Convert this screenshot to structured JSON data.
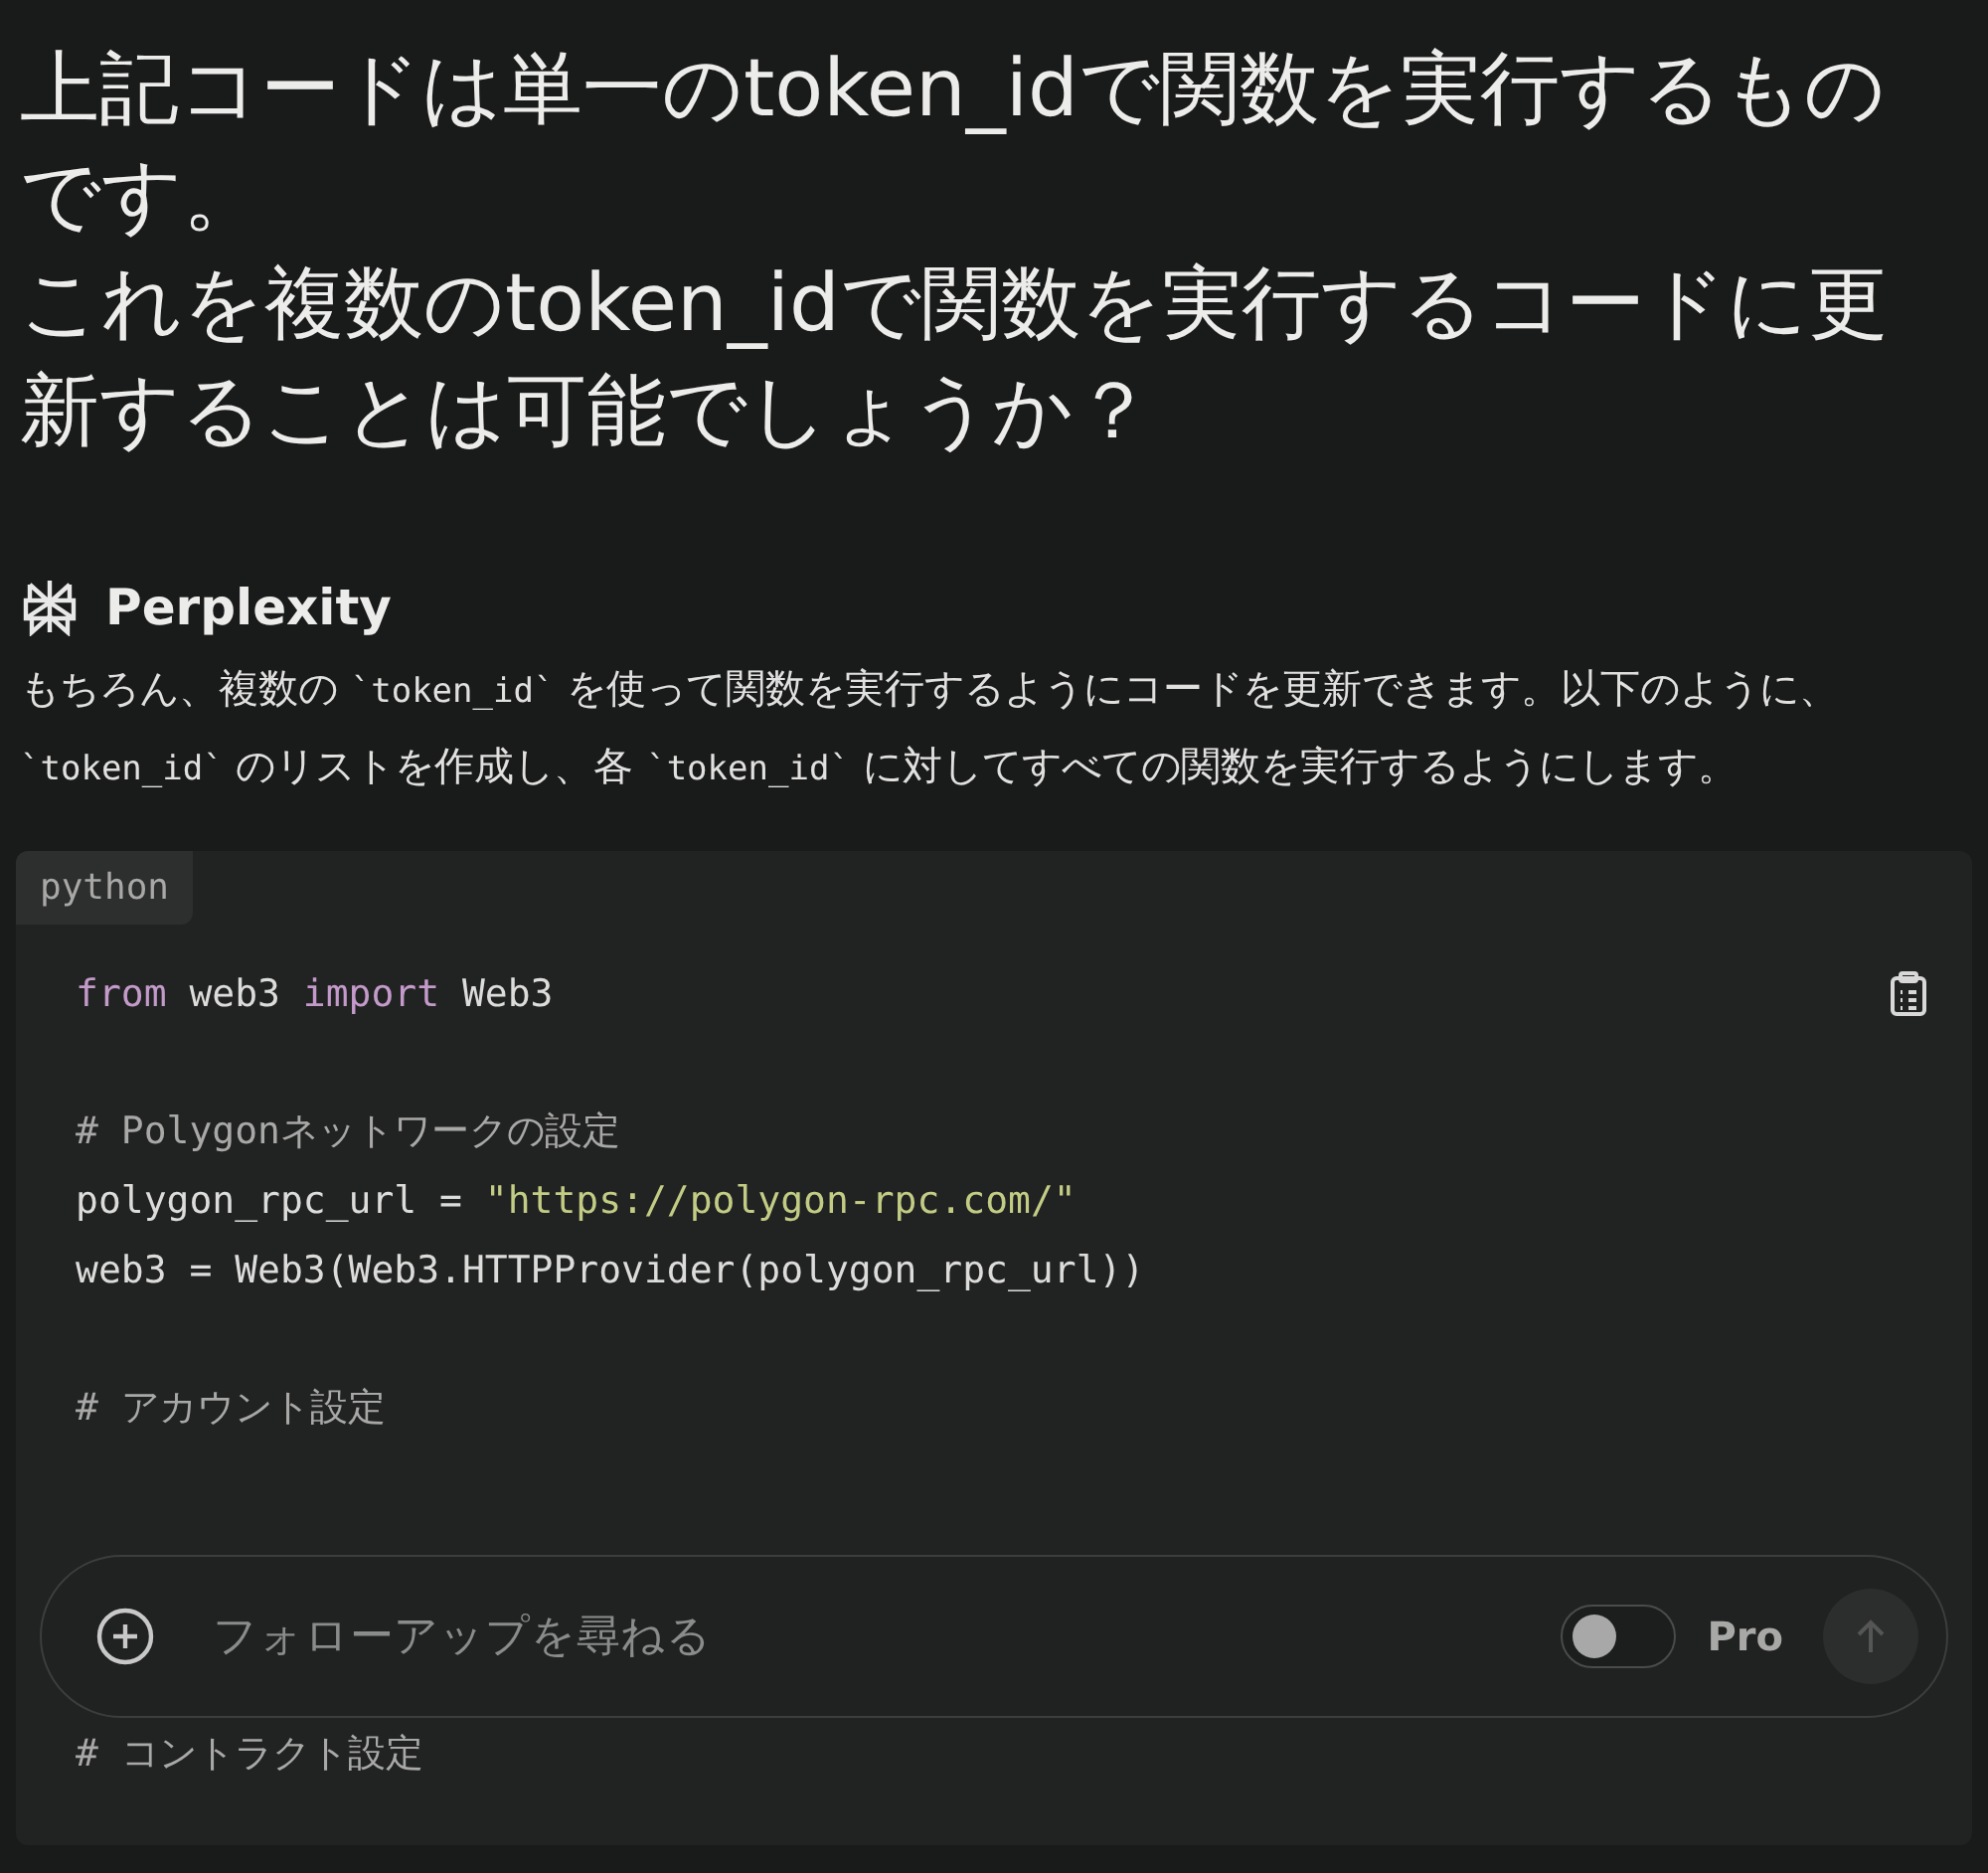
{
  "question": [
    "上記コードは単一のtoken_idで関数を実行するものです。",
    "これを複数のtoken_idで関数を実行するコードに更新することは可能でしょうか？"
  ],
  "answer": {
    "source": "Perplexity",
    "paragraph": [
      {
        "kind": "text",
        "text": "もちろん、複数の "
      },
      {
        "kind": "code",
        "text": "`token_id`"
      },
      {
        "kind": "text",
        "text": " を使って関数を実行するようにコードを更新できます。以下のように、"
      },
      {
        "kind": "code",
        "text": "`token_id`"
      },
      {
        "kind": "text",
        "text": " のリストを作成し、各 "
      },
      {
        "kind": "code",
        "text": "`token_id`"
      },
      {
        "kind": "text",
        "text": " に対してすべての関数を実行するようにします。"
      }
    ]
  },
  "code_block": {
    "language": "python",
    "lines": [
      {
        "kind": "code",
        "segments": [
          {
            "kind": "keyword",
            "text": "from"
          },
          {
            "kind": "plain",
            "text": " web3 "
          },
          {
            "kind": "keyword",
            "text": "import"
          },
          {
            "kind": "plain",
            "text": " Web3"
          }
        ]
      },
      {
        "kind": "blank"
      },
      {
        "kind": "code",
        "segments": [
          {
            "kind": "comment",
            "text": "# Polygonネットワークの設定"
          }
        ]
      },
      {
        "kind": "code",
        "segments": [
          {
            "kind": "plain",
            "text": "polygon_rpc_url = "
          },
          {
            "kind": "string",
            "text": "\"https://polygon-rpc.com/\""
          }
        ]
      },
      {
        "kind": "code",
        "segments": [
          {
            "kind": "plain",
            "text": "web3 = Web3(Web3.HTTPProvider(polygon_rpc_url))"
          }
        ]
      },
      {
        "kind": "blank"
      },
      {
        "kind": "code",
        "segments": [
          {
            "kind": "comment",
            "text": "# アカウント設定"
          }
        ]
      },
      {
        "kind": "blank"
      },
      {
        "kind": "blank"
      },
      {
        "kind": "blank"
      },
      {
        "kind": "blank"
      },
      {
        "kind": "code",
        "segments": [
          {
            "kind": "comment",
            "text": "# コントラクト設定"
          }
        ]
      }
    ]
  },
  "follow_up": {
    "placeholder": "フォローアップを尋ねる",
    "pro_toggle": {
      "label": "Pro",
      "on": false
    },
    "send_disabled": true
  }
}
